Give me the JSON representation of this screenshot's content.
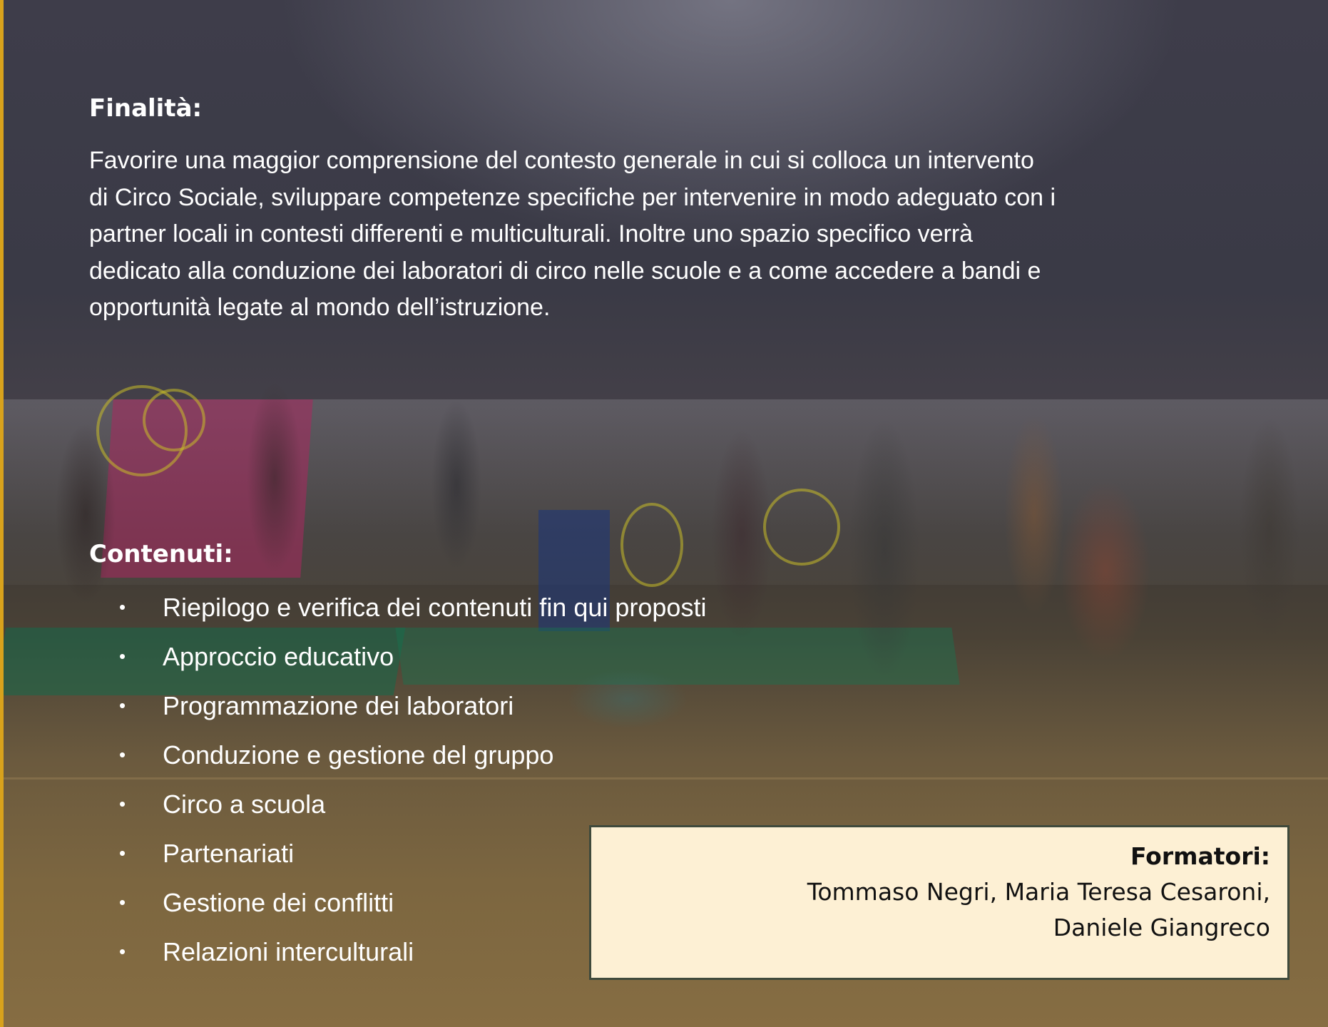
{
  "finalita": {
    "heading": "Finalità:",
    "lines": [
      "Favorire una maggior comprensione del contesto generale in cui si colloca un intervento",
      "di Circo Sociale, sviluppare competenze specifiche per intervenire in modo adeguato con i",
      "partner locali in contesti differenti e multiculturali. Inoltre uno spazio specifico verrà",
      "dedicato alla conduzione dei laboratori di circo nelle scuole e a come accedere a bandi e",
      "opportunità legate al mondo dell’istruzione."
    ]
  },
  "contenuti": {
    "heading": "Contenuti:",
    "bullet": "•",
    "items": [
      "Riepilogo e verifica dei contenuti fin qui proposti",
      "Approccio educativo",
      "Programmazione dei laboratori",
      "Conduzione e gestione del gruppo",
      "Circo a scuola",
      "Partenariati",
      "Gestione dei conflitti",
      "Relazioni interculturali"
    ]
  },
  "formatori": {
    "title": "Formatori:",
    "names_line_1": "Tommaso Negri, Maria Teresa Cesaroni,",
    "names_line_2": "Daniele Giangreco"
  },
  "colors": {
    "text": "#ffffff",
    "box_background": "#fdf0d4",
    "box_border": "#3f4a3c",
    "accent_edge": "#d8a21c"
  }
}
